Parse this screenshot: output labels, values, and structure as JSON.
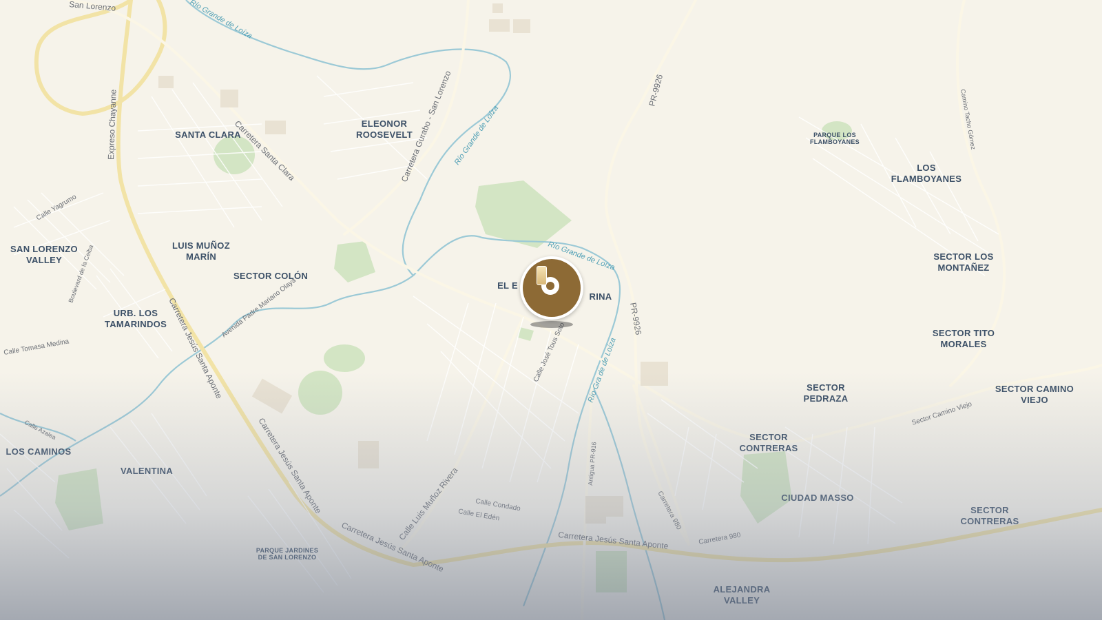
{
  "map": {
    "place_labels": [
      "SANTA CLARA",
      "ELEONOR ROOSEVELT",
      "SAN LORENZO VALLEY",
      "LUIS MUÑOZ MARÍN",
      "SECTOR COLÓN",
      "URB. LOS TAMARINDOS",
      "LOS CAMINOS",
      "VALENTINA",
      "LOS FLAMBOYANES",
      "SECTOR LOS MONTAÑEZ",
      "SECTOR TITO MORALES",
      "SECTOR PEDRAZA",
      "SECTOR CAMINO VIEJO",
      "SECTOR CONTRERAS",
      "CIUDAD MASSO",
      "SECTOR CONTRERAS",
      "ALEJANDRA VALLEY",
      "EL E",
      "RINA"
    ],
    "small_labels": [
      "PARQUE LOS FLAMBOYANES",
      "PARQUE JARDINES DE SAN LORENZO"
    ],
    "road_labels": [
      "San Lorenzo",
      "Expreso Chayanne",
      "Carretera Santa Clara",
      "Carretera Gurabo - San Lorenzo",
      "Carretera Jesús Santa Aponte",
      "Carretera Jesús Santa Aponte",
      "Carretera Jesús Santa Aponte",
      "Carretera Jesús Santa Aponte",
      "PR-9926",
      "PR-9926",
      "Calle José Tous Soto",
      "Calle Luis Muñoz Rivera",
      "Carretera 980",
      "Carretera 980",
      "Avenida Padre Mariano Olaya",
      "Calle Tomasa Medina",
      "Calle Yagrumo",
      "Boulevard de la Ceiba",
      "Sector Camino Viejo",
      "Camino Tacho Gómez",
      "Calle Condado",
      "Calle El Edén",
      "Antigua PR-916",
      "Calle Azalea"
    ],
    "water_labels": [
      "Río Grande de Loíza",
      "Río Grande de Loíza",
      "Río Grande de Loíza",
      "Río Gra de de Loíza"
    ],
    "colors": {
      "background": "#f6f3ea",
      "water": "#9bc9d6",
      "road": "#fbf6e6",
      "highway": "#f2e3a6",
      "park": "#d3e5c4",
      "marker": "#8d6a35"
    }
  },
  "marker": {
    "icon": "winery-glass-icon"
  }
}
